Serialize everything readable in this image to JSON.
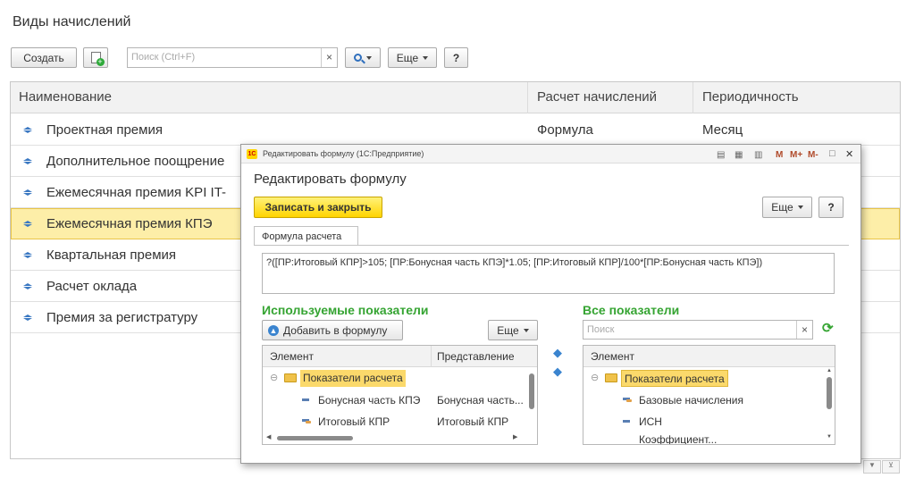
{
  "page": {
    "title": "Виды начислений",
    "toolbar": {
      "create_label": "Создать",
      "search_placeholder": "Поиск (Ctrl+F)",
      "search_clear": "×",
      "more_label": "Еще",
      "help_label": "?"
    },
    "table": {
      "columns": [
        "Наименование",
        "Расчет начислений",
        "Периодичность"
      ],
      "rows": [
        {
          "name": "Проектная премия",
          "calc": "Формула",
          "period": "Месяц"
        },
        {
          "name": "Дополнительное поощрение",
          "calc": "",
          "period": ""
        },
        {
          "name": "Ежемесячная премия KPI IT-",
          "calc": "",
          "period": ""
        },
        {
          "name": "Ежемесячная премия КПЭ",
          "calc": "",
          "period": ""
        },
        {
          "name": "Квартальная премия",
          "calc": "",
          "period": ""
        },
        {
          "name": "Расчет оклада",
          "calc": "",
          "period": ""
        },
        {
          "name": "Премия за регистратуру",
          "calc": "",
          "period": ""
        }
      ],
      "selected_row": 3
    }
  },
  "dialog": {
    "window_title": "Редактировать формулу  (1С:Предприятие)",
    "app_badge": "1С",
    "titlebar_buttons": [
      "M",
      "M+",
      "M-",
      "□",
      "✕"
    ],
    "heading": "Редактировать формулу",
    "save_close_label": "Записать и закрыть",
    "more_label": "Еще",
    "help_label": "?",
    "tab_label": "Формула расчета",
    "formula_text": "?([ПР:Итоговый КПР]>105; [ПР:Бонусная часть КПЭ]*1.05; [ПР:Итоговый КПР]/100*[ПР:Бонусная часть КПЭ])",
    "used": {
      "title": "Используемые показатели",
      "add_label": "Добавить в формулу",
      "more_label": "Еще",
      "columns": [
        "Элемент",
        "Представление"
      ],
      "group": "Показатели расчета",
      "items": [
        {
          "name": "Бонусная часть КПЭ",
          "repr": "Бонусная часть..."
        },
        {
          "name": "Итоговый КПР",
          "repr": "Итоговый КПР"
        }
      ]
    },
    "all": {
      "title": "Все показатели",
      "search_placeholder": "Поиск",
      "search_clear": "×",
      "columns": [
        "Элемент"
      ],
      "group": "Показатели расчета",
      "items": [
        "Базовые начисления",
        "ИСН",
        "Коэффициент..."
      ]
    }
  },
  "colors": {
    "accent_yellow": "#ffe300",
    "selected_row": "#fdeea8",
    "group_highlight": "#fbd96b",
    "section_title": "#35a432",
    "arrow_blue": "#3a78c2"
  }
}
